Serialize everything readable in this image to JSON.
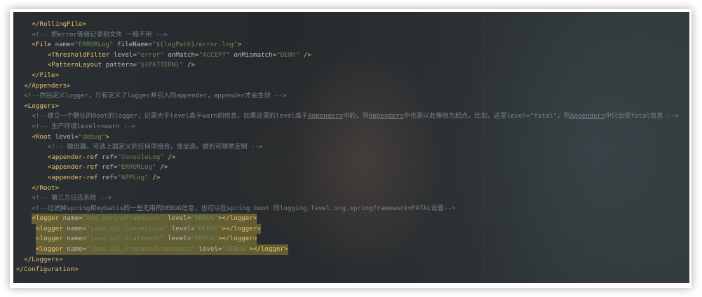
{
  "editor": {
    "lines": [
      {
        "indent": 4,
        "parts": [
          {
            "k": "t",
            "s": "</RollingFile>"
          }
        ]
      },
      {
        "indent": 4,
        "parts": [
          {
            "k": "c",
            "s": "<!-- 把error等级记录到文件 一般不用 -->"
          }
        ]
      },
      {
        "indent": 4,
        "parts": [
          {
            "k": "t",
            "s": "<File "
          },
          {
            "k": "a",
            "s": "name="
          },
          {
            "k": "v",
            "s": "\"ERRORLog\""
          },
          {
            "k": "a",
            "s": " fileName="
          },
          {
            "k": "v",
            "s": "\"${logPath}/error.log\""
          },
          {
            "k": "t",
            "s": ">"
          }
        ]
      },
      {
        "indent": 8,
        "parts": [
          {
            "k": "t",
            "s": "<ThresholdFilter "
          },
          {
            "k": "a",
            "s": "level="
          },
          {
            "k": "v",
            "s": "\"error\""
          },
          {
            "k": "a",
            "s": " onMatch="
          },
          {
            "k": "v",
            "s": "\"ACCEPT\""
          },
          {
            "k": "a",
            "s": " onMismatch="
          },
          {
            "k": "v",
            "s": "\"DENY\""
          },
          {
            "k": "t",
            "s": " />"
          }
        ]
      },
      {
        "indent": 8,
        "parts": [
          {
            "k": "t",
            "s": "<PatternLayout "
          },
          {
            "k": "a",
            "s": "pattern="
          },
          {
            "k": "v",
            "s": "\"${PATTERN}\""
          },
          {
            "k": "t",
            "s": " />"
          }
        ]
      },
      {
        "indent": 4,
        "parts": [
          {
            "k": "t",
            "s": "</File>"
          }
        ]
      },
      {
        "indent": 2,
        "parts": [
          {
            "k": "t",
            "s": "</Appenders>"
          }
        ]
      },
      {
        "indent": 2,
        "parts": [
          {
            "k": "c",
            "s": "<!--然后定义logger，只有定义了logger并引入的appender，appender才会生效 -->"
          }
        ]
      },
      {
        "indent": 2,
        "parts": [
          {
            "k": "t",
            "s": "<Loggers>"
          }
        ]
      },
      {
        "indent": 4,
        "parts": [
          {
            "k": "c",
            "s": "<!--建立一个默认的Root的logger，记录大于level高于warn的信息，如果这里的level高于"
          },
          {
            "k": "cu",
            "s": "Appenders"
          },
          {
            "k": "c",
            "s": "中的，则"
          },
          {
            "k": "cu",
            "s": "Appenders"
          },
          {
            "k": "c",
            "s": "中也是以此等级为起点，比如，这里level=\"fatal\"，则"
          },
          {
            "k": "cu",
            "s": "Appenders"
          },
          {
            "k": "c",
            "s": "中只出现fatal信息 -->"
          }
        ]
      },
      {
        "indent": 4,
        "parts": [
          {
            "k": "c",
            "s": "<!-- 生产环境level>=warn -->"
          }
        ]
      },
      {
        "indent": 4,
        "parts": [
          {
            "k": "t",
            "s": "<Root "
          },
          {
            "k": "a",
            "s": "level="
          },
          {
            "k": "v",
            "s": "\"debug\""
          },
          {
            "k": "t",
            "s": ">"
          }
        ]
      },
      {
        "indent": 8,
        "parts": [
          {
            "k": "c",
            "s": "<!-- 输出器，可选上面定义的任何项组合，或全选，做到可随意定制 -->"
          }
        ]
      },
      {
        "indent": 8,
        "parts": [
          {
            "k": "t",
            "s": "<appender-ref "
          },
          {
            "k": "a",
            "s": "ref="
          },
          {
            "k": "v",
            "s": "\"ConsoleLog\""
          },
          {
            "k": "t",
            "s": " />"
          }
        ]
      },
      {
        "indent": 8,
        "parts": [
          {
            "k": "t",
            "s": "<appender-ref "
          },
          {
            "k": "a",
            "s": "ref="
          },
          {
            "k": "v",
            "s": "\"ERRORLog\""
          },
          {
            "k": "t",
            "s": " />"
          }
        ]
      },
      {
        "indent": 8,
        "parts": [
          {
            "k": "t",
            "s": "<appender-ref "
          },
          {
            "k": "a",
            "s": "ref="
          },
          {
            "k": "v",
            "s": "\"APPLog\""
          },
          {
            "k": "t",
            "s": " />"
          }
        ]
      },
      {
        "indent": 4,
        "parts": [
          {
            "k": "t",
            "s": "</Root>"
          }
        ]
      },
      {
        "indent": 4,
        "parts": [
          {
            "k": "c",
            "s": "<!-- 第三方日志系统 -->"
          }
        ]
      },
      {
        "indent": 4,
        "parts": [
          {
            "k": "c",
            "s": "<!--过滤掉spring和mybatis的一些无用的DEBUG信息，也可以在spring boot 的logging.level.org.springframework=FATAL设置-->"
          }
        ]
      },
      {
        "indent": 4,
        "hl": true,
        "parts": [
          {
            "k": "t",
            "s": "<logger "
          },
          {
            "k": "a",
            "s": "name="
          },
          {
            "k": "v",
            "s": "\"org.springframework\""
          },
          {
            "k": "a",
            "s": " level="
          },
          {
            "k": "v",
            "s": "\"DEBUG\""
          },
          {
            "k": "t",
            "s": "></logger>"
          }
        ]
      },
      {
        "indent": 5,
        "hl": true,
        "parts": [
          {
            "k": "t",
            "s": "<logger "
          },
          {
            "k": "a",
            "s": "name="
          },
          {
            "k": "v",
            "s": "\"java.sql.Connection\""
          },
          {
            "k": "a",
            "s": " level="
          },
          {
            "k": "v",
            "s": "\"DEBUG\""
          },
          {
            "k": "t",
            "s": "></logger>"
          }
        ]
      },
      {
        "indent": 5,
        "hl": true,
        "parts": [
          {
            "k": "t",
            "s": "<logger "
          },
          {
            "k": "a",
            "s": "name="
          },
          {
            "k": "v",
            "s": "\"java.sql.Statement\""
          },
          {
            "k": "a",
            "s": " level="
          },
          {
            "k": "v",
            "s": "\"DEBUG\""
          },
          {
            "k": "t",
            "s": "></logger>"
          }
        ]
      },
      {
        "indent": 5,
        "hl": true,
        "parts": [
          {
            "k": "t",
            "s": "<logger "
          },
          {
            "k": "a",
            "s": "name="
          },
          {
            "k": "v",
            "s": "\"java.sql.PreparedStatement\""
          },
          {
            "k": "a",
            "s": " level="
          },
          {
            "k": "v",
            "s": "\"DEBUG\""
          },
          {
            "k": "t",
            "s": "></logger>"
          }
        ]
      },
      {
        "indent": 2,
        "parts": [
          {
            "k": "t",
            "s": "</Loggers>"
          }
        ]
      },
      {
        "indent": 0,
        "parts": [
          {
            "k": "t",
            "s": "</Configuration>"
          }
        ]
      }
    ]
  }
}
